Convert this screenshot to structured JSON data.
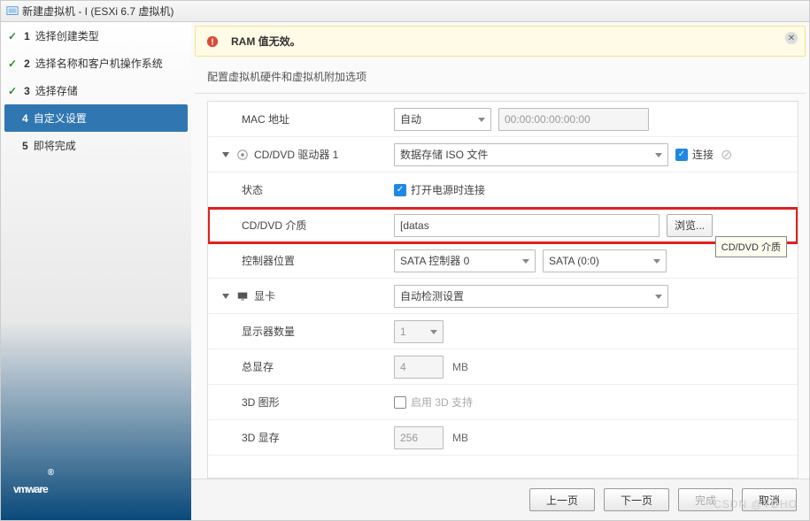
{
  "title": "新建虚拟机 - I               (ESXi 6.7 虚拟机)",
  "alert": {
    "message": "RAM 值无效。"
  },
  "subtitle": "配置虚拟机硬件和虚拟机附加选项",
  "sidebar": {
    "steps": [
      {
        "num": "1",
        "label": "选择创建类型"
      },
      {
        "num": "2",
        "label": "选择名称和客户机操作系统"
      },
      {
        "num": "3",
        "label": "选择存储"
      },
      {
        "num": "4",
        "label": "自定义设置"
      },
      {
        "num": "5",
        "label": "即将完成"
      }
    ],
    "logo": "vmware"
  },
  "form": {
    "mac": {
      "label": "MAC 地址",
      "mode": "自动",
      "value": "00:00:00:00:00:00"
    },
    "cdrom": {
      "header": "CD/DVD 驱动器 1",
      "source": "数据存储 ISO 文件",
      "connect_label": "连接",
      "status_label": "状态",
      "poweron_label": "打开电源时连接",
      "media_label": "CD/DVD 介质",
      "media_value": "[datas",
      "browse": "浏览...",
      "tooltip": "CD/DVD 介质",
      "ctrl_label": "控制器位置",
      "ctrl": "SATA 控制器 0",
      "port": "SATA (0:0)"
    },
    "video": {
      "header": "显卡",
      "mode": "自动检测设置",
      "displays_label": "显示器数量",
      "displays": "1",
      "totalmem_label": "总显存",
      "totalmem": "4",
      "unit": "MB",
      "threed_label": "3D 图形",
      "threed_check": "启用 3D 支持",
      "threed_mem_label": "3D 显存",
      "threed_mem": "256"
    }
  },
  "footer": {
    "prev": "上一页",
    "next": "下一页",
    "finish": "完成",
    "cancel": "取消"
  },
  "watermark": "CSDN @YOHO"
}
